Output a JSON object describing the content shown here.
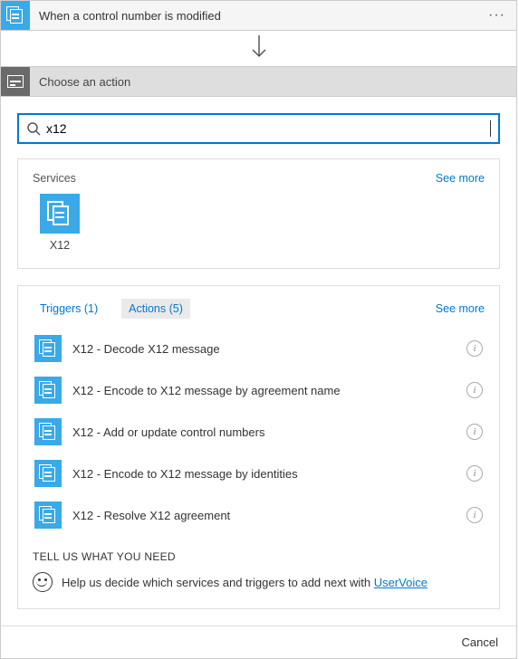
{
  "colors": {
    "accent": "#3aa9e8",
    "link": "#0078d4"
  },
  "trigger": {
    "title": "When a control number is modified"
  },
  "choose": {
    "title": "Choose an action"
  },
  "search": {
    "value": "x12",
    "placeholder": ""
  },
  "services": {
    "heading": "Services",
    "see_more": "See more",
    "items": [
      {
        "name": "X12",
        "icon": "doc-stack-icon"
      }
    ]
  },
  "tabs": {
    "triggers_label": "Triggers (1)",
    "actions_label": "Actions (5)",
    "see_more": "See more"
  },
  "actions": [
    {
      "label": "X12 - Decode X12 message",
      "icon": "doc-stack-icon"
    },
    {
      "label": "X12 - Encode to X12 message by agreement name",
      "icon": "doc-stack-icon"
    },
    {
      "label": "X12 - Add or update control numbers",
      "icon": "doc-stack-icon"
    },
    {
      "label": "X12 - Encode to X12 message by identities",
      "icon": "doc-stack-icon"
    },
    {
      "label": "X12 - Resolve X12 agreement",
      "icon": "doc-stack-icon"
    }
  ],
  "feedback": {
    "heading": "TELL US WHAT YOU NEED",
    "text": "Help us decide which services and triggers to add next with ",
    "link": "UserVoice"
  },
  "footer": {
    "cancel": "Cancel"
  }
}
